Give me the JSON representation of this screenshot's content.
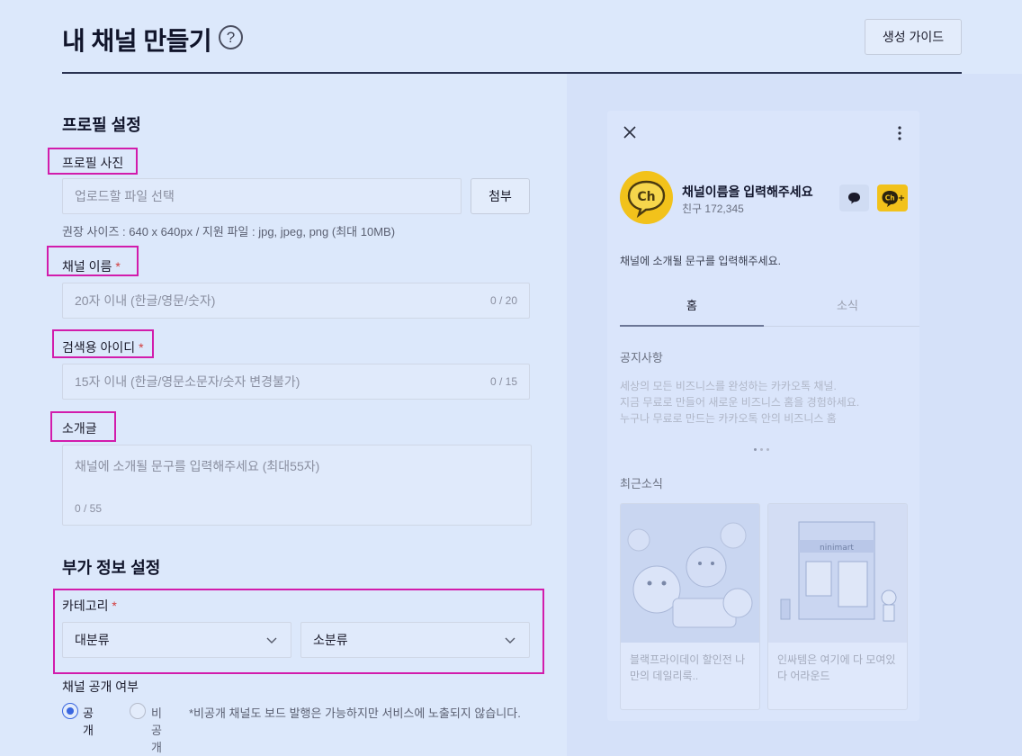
{
  "header": {
    "title": "내 채널 만들기",
    "help_icon": "?",
    "guide_label": "생성 가이드"
  },
  "profile": {
    "section_title": "프로필 설정",
    "photo_label": "프로필 사진",
    "photo_placeholder": "업로드할 파일 선택",
    "attach_label": "첨부",
    "photo_hint": "권장 사이즈 : 640 x 640px / 지원 파일 : jpg, jpeg, png (최대 10MB)",
    "name_label": "채널 이름",
    "name_placeholder": "20자 이내 (한글/영문/숫자)",
    "name_counter": "0 / 20",
    "search_id_label": "검색용 아이디",
    "search_id_placeholder": "15자 이내 (한글/영문소문자/숫자 변경불가)",
    "search_id_counter": "0 / 15",
    "intro_label": "소개글",
    "intro_placeholder": "채널에 소개될 문구를 입력해주세요 (최대55자)",
    "intro_counter": "0 / 55",
    "required_mark": "*"
  },
  "extra": {
    "section_title": "부가 정보 설정",
    "category_label": "카테고리",
    "major_select": "대분류",
    "minor_select": "소분류",
    "visibility_label": "채널 공개 여부",
    "public_label": "공개",
    "private_label": "비공개",
    "private_note": "*비공개 채널도 보드 발행은 가능하지만 서비스에 노출되지 않습니다."
  },
  "preview": {
    "avatar_text": "Ch",
    "channel_name": "채널이름을 입력해주세요",
    "friends": "친구 172,345",
    "add_badge": "Ch+",
    "intro": "채널에 소개될 문구를 입력해주세요.",
    "tab_home": "홈",
    "tab_news": "소식",
    "notice_title": "공지사항",
    "notice_lines": [
      "세상의 모든 비즈니스를 완성하는 카카오톡 채널.",
      "지금 무료로 만들어 새로운 비즈니스 홈을 경험하세요.",
      "누구나 무료로 만드는 카카오톡 안의 비즈니스 홈"
    ],
    "news_title": "최근소식",
    "news_cards": [
      {
        "text": "블랙프라이데이 할인전 나만의 데일리룩.."
      },
      {
        "text": "인싸템은 여기에 다 모여있다 어라운드",
        "store_sign": "ninimart"
      }
    ]
  },
  "colors": {
    "background": "#dce8fb",
    "highlight": "#d21cac",
    "accent_blue": "#3a67e0",
    "kakao_yellow": "#f2c21b",
    "required_red": "#d23c3c"
  }
}
